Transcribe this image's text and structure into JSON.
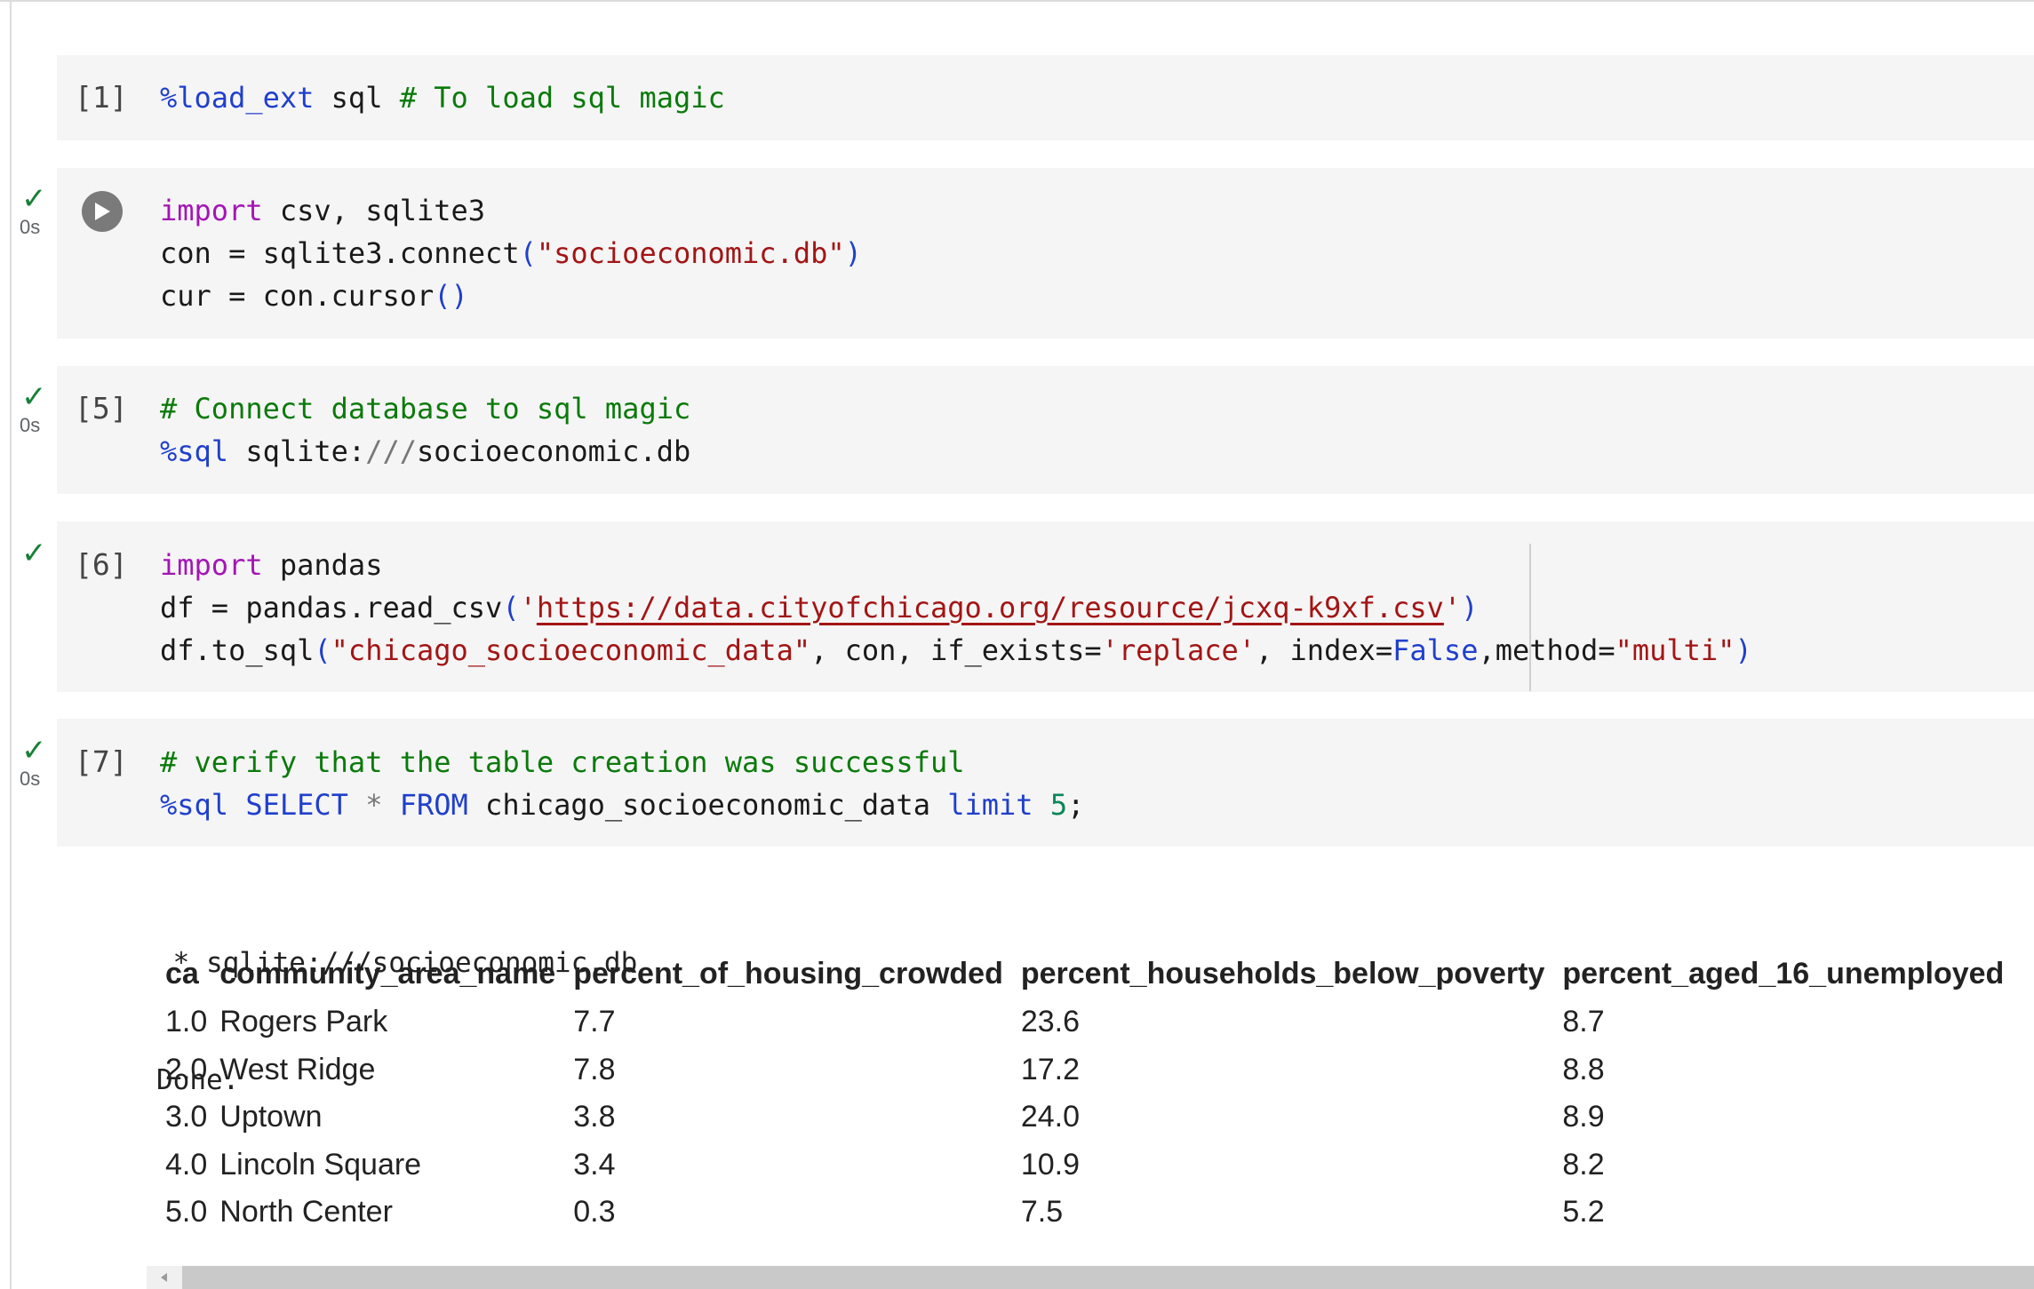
{
  "cells": [
    {
      "id": "cell-1",
      "status": "",
      "exec_time": "",
      "count": "[1]",
      "lines": [
        [
          [
            "c-blue",
            "%load_ext"
          ],
          [
            "",
            " sql "
          ],
          [
            "c-green",
            "# To load sql magic"
          ]
        ]
      ]
    },
    {
      "id": "cell-2",
      "status": "✓",
      "exec_time": "0s",
      "count": "",
      "lines": [
        [
          [
            "c-purple",
            "import"
          ],
          [
            "",
            " csv, sqlite3"
          ]
        ],
        [
          [
            "",
            "con = sqlite3.connect"
          ],
          [
            "c-blue",
            "("
          ],
          [
            "c-red",
            "\"socioeconomic.db\""
          ],
          [
            "c-blue",
            ")"
          ]
        ],
        [
          [
            "",
            "cur = con.cursor"
          ],
          [
            "c-blue",
            "()"
          ]
        ]
      ]
    },
    {
      "id": "cell-3",
      "status": "✓",
      "exec_time": "0s",
      "count": "[5]",
      "lines": [
        [
          [
            "c-green",
            "# Connect database to sql magic"
          ]
        ],
        [
          [
            "c-blue",
            "%sql"
          ],
          [
            "",
            " sqlite:"
          ],
          [
            "c-gray",
            "///"
          ],
          [
            "",
            "socioeconomic.db"
          ]
        ]
      ]
    },
    {
      "id": "cell-4",
      "status": "✓",
      "exec_time": "",
      "count": "[6]",
      "lines": [
        [
          [
            "c-purple",
            "import"
          ],
          [
            "",
            " pandas"
          ]
        ],
        [
          [
            "",
            "df = pandas.read_csv"
          ],
          [
            "c-blue",
            "("
          ],
          [
            "c-red",
            "'"
          ],
          [
            "c-url",
            "https://data.cityofchicago.org/resource/jcxq-k9xf.csv"
          ],
          [
            "c-red",
            "'"
          ],
          [
            "c-blue",
            ")"
          ]
        ],
        [
          [
            "",
            "df.to_sql"
          ],
          [
            "c-blue",
            "("
          ],
          [
            "c-red",
            "\"chicago_socioeconomic_data\""
          ],
          [
            "",
            ", con, if_exists="
          ],
          [
            "c-red",
            "'replace'"
          ],
          [
            "",
            ", index="
          ],
          [
            "c-blue",
            "False"
          ],
          [
            "",
            ",method="
          ],
          [
            "c-red",
            "\"multi\""
          ],
          [
            "c-blue",
            ")"
          ]
        ]
      ]
    },
    {
      "id": "cell-5",
      "status": "✓",
      "exec_time": "0s",
      "count": "[7]",
      "lines": [
        [
          [
            "c-green",
            "# verify that the table creation was successful"
          ]
        ],
        [
          [
            "c-blue",
            "%sql"
          ],
          [
            "",
            " "
          ],
          [
            "c-blue",
            "SELECT"
          ],
          [
            "",
            " "
          ],
          [
            "c-gray",
            "*"
          ],
          [
            "",
            " "
          ],
          [
            "c-blue",
            "FROM"
          ],
          [
            "",
            " chicago_socioeconomic_data "
          ],
          [
            "c-blue",
            "limit"
          ],
          [
            "",
            " "
          ],
          [
            "c-teal",
            "5"
          ],
          [
            "",
            ";"
          ]
        ]
      ]
    }
  ],
  "output": {
    "connection_line": " * sqlite:///socioeconomic.db",
    "done_line": "Done."
  },
  "table": {
    "columns": [
      "ca",
      "community_area_name",
      "percent_of_housing_crowded",
      "percent_households_below_poverty",
      "percent_aged_16_unemployed"
    ],
    "rows": [
      [
        "1.0",
        "Rogers Park",
        "7.7",
        "23.6",
        "8.7"
      ],
      [
        "2.0",
        "West Ridge",
        "7.8",
        "17.2",
        "8.8"
      ],
      [
        "3.0",
        "Uptown",
        "3.8",
        "24.0",
        "8.9"
      ],
      [
        "4.0",
        "Lincoln Square",
        "3.4",
        "10.9",
        "8.2"
      ],
      [
        "5.0",
        "North Center",
        "0.3",
        "7.5",
        "5.2"
      ]
    ]
  },
  "icons": {
    "run": "play-icon",
    "status": "checkmark-icon",
    "scroll_left": "chevron-left-icon"
  }
}
